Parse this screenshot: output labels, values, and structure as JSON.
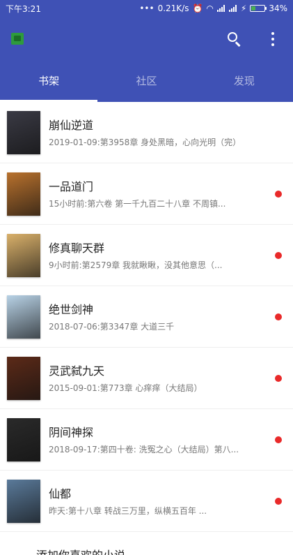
{
  "status": {
    "time": "下午3:21",
    "dots": "•••",
    "speed": "0.21K/s",
    "battery": "34%",
    "battery_level": 0.34
  },
  "appbar": {
    "logo_icon": "app-logo-icon",
    "search_icon": "search-icon",
    "more_icon": "more-vert-icon"
  },
  "tabs": [
    "书架",
    "社区",
    "发现"
  ],
  "active_tab": 0,
  "colors": {
    "primary": "#3f51b5",
    "unread_dot": "#e92a2a"
  },
  "books": [
    {
      "title": "崩仙逆道",
      "subtitle": "2019-01-09:第3958章  身处黑暗，心向光明（完）",
      "unread": false,
      "cover_color": "#3a3a44"
    },
    {
      "title": "一品道门",
      "subtitle": "15小时前:第六卷 第一千九百二十八章 不周镇...",
      "unread": true,
      "cover_color": "#b8712d"
    },
    {
      "title": "修真聊天群",
      "subtitle": "9小时前:第2579章 我就瞅瞅，没其他意思（...",
      "unread": true,
      "cover_color": "#d9b06a"
    },
    {
      "title": "绝世剑神",
      "subtitle": "2018-07-06:第3347章    大道三千",
      "unread": true,
      "cover_color": "#b8d2e6"
    },
    {
      "title": "灵武弑九天",
      "subtitle": "2015-09-01:第773章 心痒痒（大结局）",
      "unread": true,
      "cover_color": "#5c2a18"
    },
    {
      "title": "阴间神探",
      "subtitle": "2018-09-17:第四十卷: 洗冤之心（大结局）第八...",
      "unread": true,
      "cover_color": "#2a2a2a"
    },
    {
      "title": "仙都",
      "subtitle": "昨天:第十八章 转战三万里，纵横五百年 ...",
      "unread": true,
      "cover_color": "#5a7a9a"
    }
  ],
  "add_label": "添加你喜欢的小说"
}
